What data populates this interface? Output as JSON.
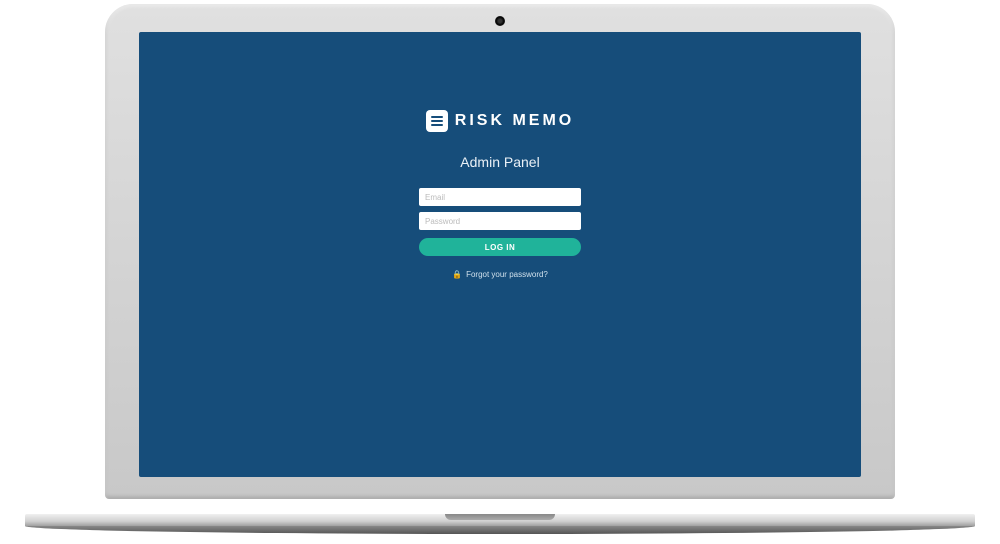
{
  "brand": {
    "name": "RISK MEMO"
  },
  "page": {
    "title": "Admin Panel"
  },
  "form": {
    "email_placeholder": "Email",
    "password_placeholder": "Password",
    "submit_label": "LOG IN"
  },
  "links": {
    "forgot_label": "Forgot your password?"
  }
}
